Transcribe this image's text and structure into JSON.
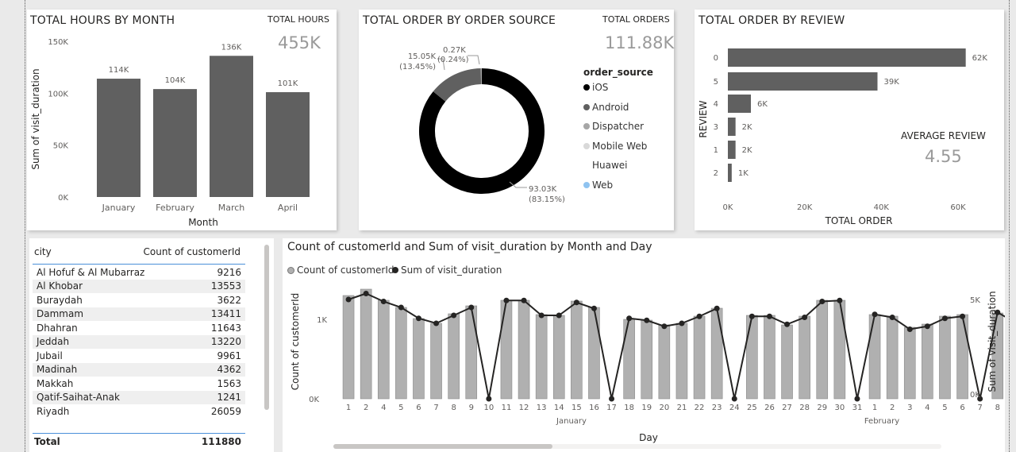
{
  "colors": {
    "bar": "#606060",
    "donut_ios": "#000000",
    "donut_android": "#606060",
    "donut_dispatcher": "#a6a6a6",
    "donut_mobileweb": "#d9d9d9",
    "donut_web": "#8fc3f0",
    "combo_bar": "#b0b0b0",
    "line": "#252423",
    "kpi": "#9a9a9a"
  },
  "hours_card": {
    "title": "TOTAL HOURS BY MONTH",
    "kpi_label": "TOTAL HOURS",
    "kpi_value": "455K"
  },
  "orders_card": {
    "title": "TOTAL ORDER BY ORDER SOURCE",
    "kpi_label": "TOTAL ORDERS",
    "kpi_value": "111.88K",
    "legend_title": "order_source"
  },
  "review_card": {
    "title": "TOTAL ORDER BY REVIEW",
    "kpi_label": "AVERAGE REVIEW",
    "kpi_value": "4.55"
  },
  "city_table": {
    "headers": [
      "city",
      "Count of customerId"
    ],
    "rows": [
      [
        "Al Hofuf & Al Mubarraz",
        "9216"
      ],
      [
        "Al Khobar",
        "13553"
      ],
      [
        "Buraydah",
        "3622"
      ],
      [
        "Dammam",
        "13411"
      ],
      [
        "Dhahran",
        "11643"
      ],
      [
        "Jeddah",
        "13220"
      ],
      [
        "Jubail",
        "9961"
      ],
      [
        "Madinah",
        "4362"
      ],
      [
        "Makkah",
        "1563"
      ],
      [
        "Qatif-Saihat-Anak",
        "1241"
      ],
      [
        "Riyadh",
        "26059"
      ]
    ],
    "total_label": "Total",
    "total_value": "111880"
  },
  "combo_card": {
    "title": "Count of customerId and Sum of visit_duration by Month and Day",
    "legend": [
      "Count of customerId",
      "Sum of visit_duration"
    ]
  },
  "chart_data": [
    {
      "type": "bar",
      "title": "TOTAL HOURS BY MONTH",
      "categories": [
        "January",
        "February",
        "March",
        "April"
      ],
      "values": [
        114000,
        104000,
        136000,
        101000
      ],
      "data_labels": [
        "114K",
        "104K",
        "136K",
        "101K"
      ],
      "xlabel": "Month",
      "ylabel": "Sum of visit_duration",
      "ylim": [
        0,
        150000
      ],
      "yticks": [
        "0K",
        "50K",
        "100K",
        "150K"
      ]
    },
    {
      "type": "pie",
      "title": "TOTAL ORDER BY ORDER SOURCE",
      "categories": [
        "iOS",
        "Android",
        "Dispatcher",
        "Mobile Web",
        "Huawei",
        "Web"
      ],
      "values": [
        93030,
        15050,
        270,
        0,
        0,
        0
      ],
      "data_labels": [
        {
          "value": "93.03K",
          "pct": "(83.15%)"
        },
        {
          "value": "15.05K",
          "pct": "(13.45%)"
        },
        {
          "value": "0.27K",
          "pct": "(0.24%)"
        }
      ],
      "legend_title": "order_source"
    },
    {
      "type": "bar",
      "orientation": "horizontal",
      "title": "TOTAL ORDER BY REVIEW",
      "categories": [
        "0",
        "5",
        "4",
        "3",
        "1",
        "2"
      ],
      "values": [
        62000,
        39000,
        6000,
        2000,
        2000,
        1000
      ],
      "data_labels": [
        "62K",
        "39K",
        "6K",
        "2K",
        "2K",
        "1K"
      ],
      "xlabel": "TOTAL ORDER",
      "ylabel": "REVIEW",
      "xlim": [
        0,
        64000
      ],
      "xticks": [
        "0K",
        "20K",
        "40K",
        "60K"
      ]
    },
    {
      "type": "bar",
      "title": "Count of customerId and Sum of visit_duration by Month and Day",
      "xlabel": "Day",
      "ylabel": "Count of customerId",
      "y2label": "Sum of visit_duration",
      "x": [
        "1",
        "2",
        "4",
        "5",
        "6",
        "7",
        "8",
        "9",
        "10",
        "11",
        "12",
        "13",
        "14",
        "15",
        "16",
        "17",
        "18",
        "19",
        "20",
        "21",
        "22",
        "23",
        "24",
        "25",
        "26",
        "27",
        "28",
        "29",
        "30",
        "31",
        "1",
        "2",
        "3",
        "4",
        "5",
        "6",
        "7",
        "8",
        "9",
        "10"
      ],
      "month_groups": [
        {
          "name": "January",
          "days": 30
        },
        {
          "name": "February",
          "days": 10
        }
      ],
      "series": [
        {
          "name": "Count of customerId",
          "type": "bar",
          "values": [
            1300,
            1380,
            1240,
            1150,
            1010,
            950,
            1070,
            1170,
            0,
            1240,
            1240,
            1060,
            1050,
            1230,
            1150,
            0,
            1000,
            990,
            930,
            950,
            1040,
            1140,
            0,
            1050,
            1050,
            930,
            1040,
            1240,
            1240,
            0,
            1060,
            1040,
            900,
            940,
            1040,
            1060,
            0,
            1080,
            970,
            910
          ]
        },
        {
          "name": "Sum of visit_duration",
          "type": "line",
          "values": [
            5000,
            5300,
            4900,
            4600,
            4050,
            3800,
            4200,
            4600,
            0,
            4950,
            4950,
            4200,
            4200,
            4850,
            4550,
            0,
            4050,
            3950,
            3650,
            3800,
            4150,
            4550,
            0,
            4150,
            4150,
            3750,
            4100,
            4900,
            4950,
            0,
            4250,
            4100,
            3500,
            3650,
            4050,
            4150,
            0,
            4350,
            3850,
            3650
          ]
        }
      ],
      "ylim": [
        0,
        1500
      ],
      "yticks": [
        "0K",
        "1K"
      ],
      "y2lim": [
        0,
        6000
      ],
      "y2ticks": [
        "0K",
        "5K"
      ]
    }
  ]
}
